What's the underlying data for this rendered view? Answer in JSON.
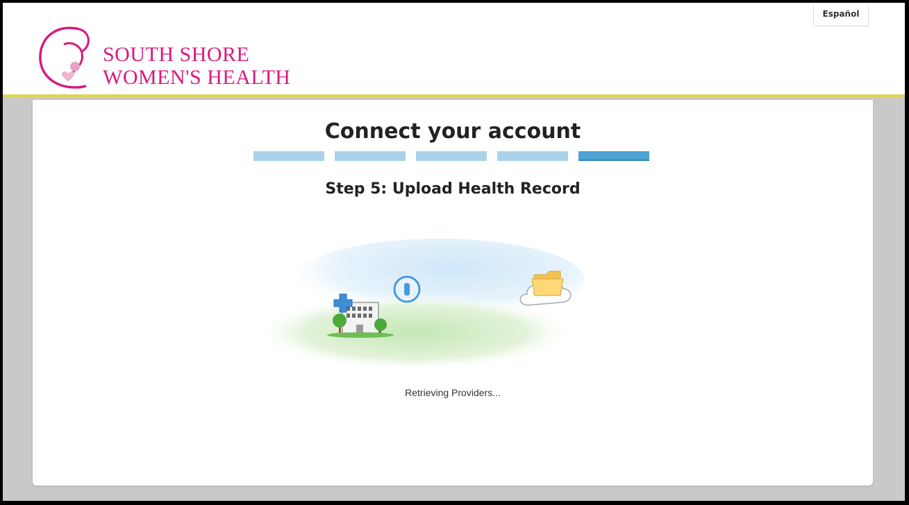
{
  "header": {
    "brand_line1": "SOUTH SHORE",
    "brand_line2": "WOMEN'S HEALTH",
    "language_button": "Español"
  },
  "main": {
    "title": "Connect your account",
    "progress": {
      "total_steps": 5,
      "current_step": 5
    },
    "step_title": "Step 5: Upload Health Record",
    "status_text": "Retrieving Providers..."
  },
  "icons": [
    "logo-mark-icon",
    "hospital-icon",
    "info-icon",
    "folder-icon",
    "cloud-icon"
  ],
  "colors": {
    "brand": "#d8197f",
    "header_rule": "#dcd65a",
    "progress_inactive": "#a9d2ea",
    "progress_active": "#4fa2d4"
  }
}
